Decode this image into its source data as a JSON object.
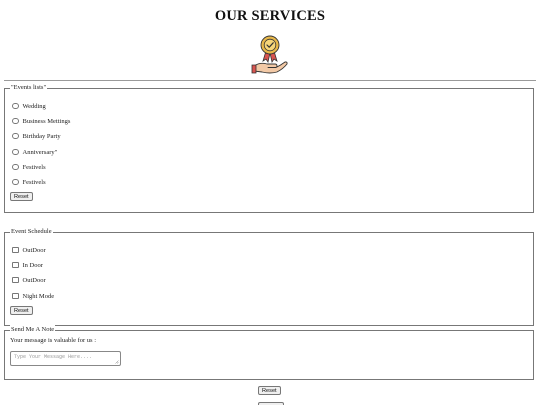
{
  "page": {
    "title": "OUR SERVICES",
    "logo_icon": "award-ribbon-on-hand-icon"
  },
  "events_list": {
    "legend": "\"Events lists\"",
    "options": [
      "Wedding",
      "Business Mettings",
      "Birthday Party",
      "Anniversary\"",
      "Festivels",
      "Festivels"
    ],
    "reset_label": "Reset"
  },
  "event_schedule": {
    "legend": "Event Schedule",
    "options": [
      "OutDoor",
      "In Door",
      "OutDoor",
      "Night Mode"
    ],
    "reset_label": "Reset"
  },
  "send_note": {
    "legend": "Send Me A Note",
    "message": "Your message is valuable for us :",
    "placeholder": "Type Your Message Here....",
    "reset_label": "Reset"
  },
  "colors": {
    "border": "#777777",
    "button_bg": "#efefef",
    "ribbon_gold": "#e8b84a",
    "ribbon_red": "#d9534f",
    "hand_skin": "#f2c9a6"
  }
}
